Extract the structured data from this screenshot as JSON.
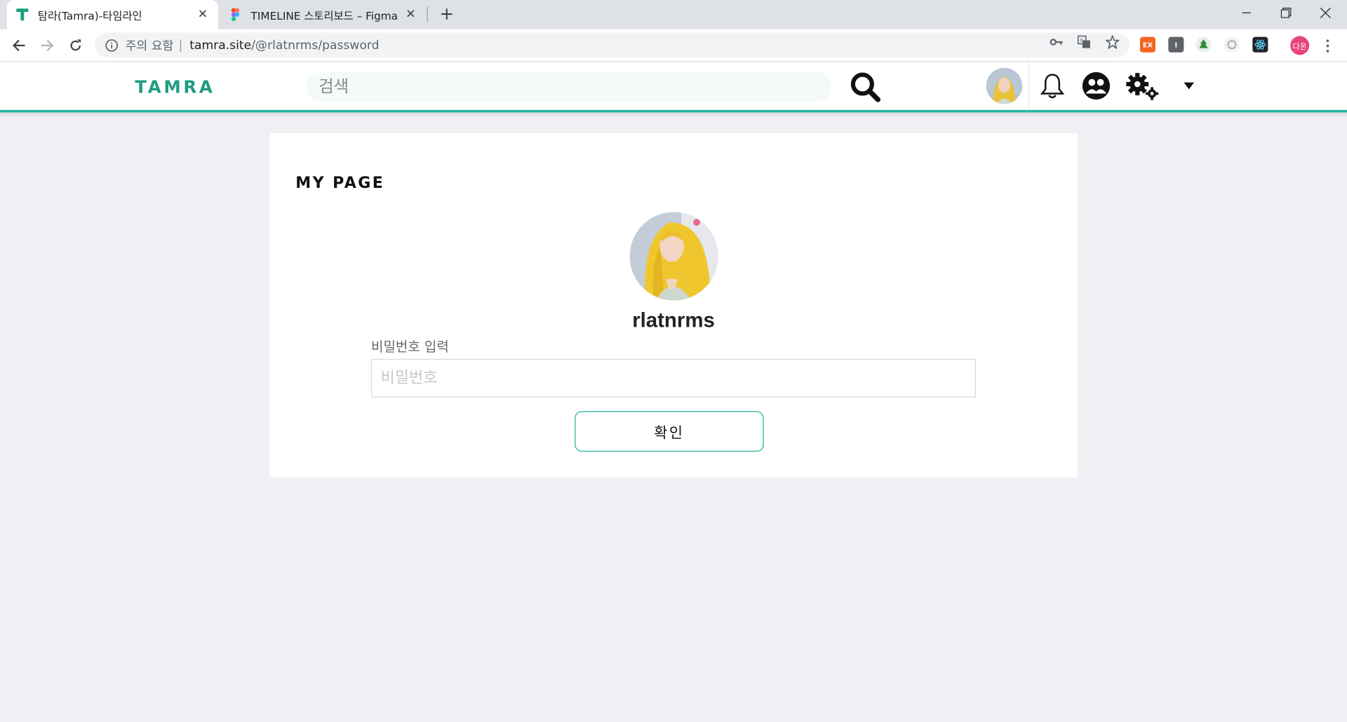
{
  "browser": {
    "tabs": [
      {
        "title": "탐라(Tamra)-타임라인",
        "active": true,
        "favicon": "tamra-t-icon"
      },
      {
        "title": "TIMELINE 스토리보드 – Figma",
        "active": false,
        "favicon": "figma-icon"
      }
    ],
    "address": {
      "security_label": "주의 요함",
      "host": "tamra.site",
      "path": "/@rlatnrms/password"
    },
    "extensions": [
      {
        "name": "ex-extension-icon",
        "label": "EX",
        "color": "#f26522"
      },
      {
        "name": "i-extension-icon",
        "label": "I",
        "color": "#5f6368"
      }
    ],
    "profile_label": "다온"
  },
  "site": {
    "logo": "TAMRA",
    "search_placeholder": "검색",
    "brand_color": "#1f9d83",
    "accent_color": "#29b7a4"
  },
  "page": {
    "title": "MY PAGE",
    "username": "rlatnrms",
    "password_label": "비밀번호 입력",
    "password_placeholder": "비밀번호",
    "confirm_label": "확인"
  }
}
